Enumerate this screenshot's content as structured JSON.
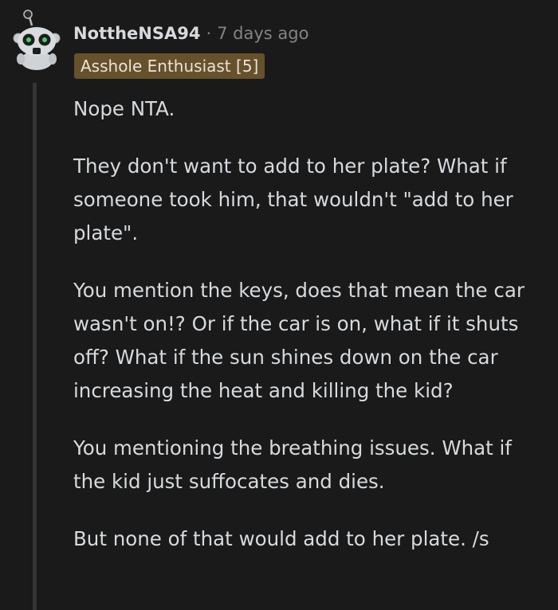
{
  "comment": {
    "username": "NottheNSA94",
    "separator": "·",
    "timestamp": "7 days ago",
    "flair": "Asshole Enthusiast [5]",
    "avatar_icon": "snoo-avatar-icon",
    "paragraphs": [
      "Nope NTA.",
      "They don't want to add to her plate? What if someone took him, that wouldn't \"add to her plate\".",
      "You mention the keys, does that mean the car wasn't on!? Or if the car is on, what if it shuts off? What if the sun shines down on the car increasing the heat and killing the kid?",
      "You mentioning the breathing issues. What if the kid just suffocates and dies.",
      "But none of that would add to her plate. /s"
    ]
  },
  "colors": {
    "background": "#1a1a1b",
    "text": "#d7dadc",
    "meta": "#818384",
    "flair_bg": "#66512b",
    "thread_line": "#343536"
  }
}
